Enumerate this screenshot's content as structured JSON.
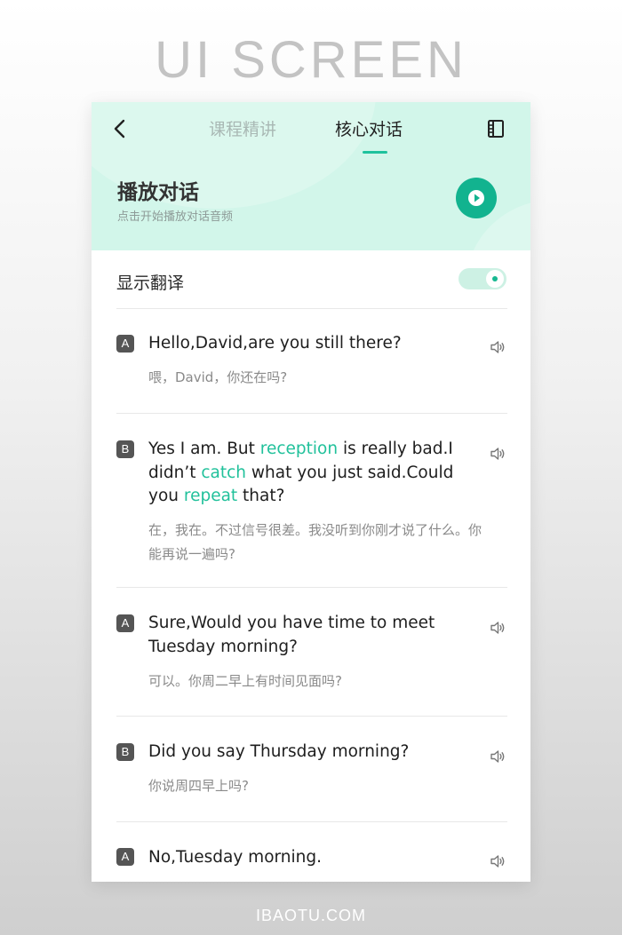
{
  "banner": {
    "title": "UI SCREEN"
  },
  "footer": {
    "watermark": "IBAOTU.COM"
  },
  "colors": {
    "accent": "#12b38f",
    "header_bg": "#d2f6ea",
    "highlight": "#21c19b"
  },
  "header": {
    "back_icon": "chevron-left-icon",
    "tabs": [
      {
        "label": "课程精讲",
        "active": false
      },
      {
        "label": "核心对话",
        "active": true
      }
    ],
    "menu_icon": "book-icon",
    "play_title": "播放对话",
    "play_subtitle": "点击开始播放对话音频",
    "play_icon": "play-icon"
  },
  "translation": {
    "label": "显示翻译",
    "enabled": true
  },
  "dialogue": [
    {
      "speaker": "A",
      "english": [
        {
          "t": "Hello,David,are you still there?"
        }
      ],
      "chinese": "喂，David，你还在吗?"
    },
    {
      "speaker": "B",
      "english": [
        {
          "t": "Yes I am. But "
        },
        {
          "t": "reception",
          "hl": true
        },
        {
          "t": " is really bad.I didn’t "
        },
        {
          "t": "catch",
          "hl": true
        },
        {
          "t": " what you just said.Could you "
        },
        {
          "t": "repeat",
          "hl": true
        },
        {
          "t": " that?"
        }
      ],
      "chinese": "在，我在。不过信号很差。我没听到你刚才说了什么。你能再说一遍吗?"
    },
    {
      "speaker": "A",
      "english": [
        {
          "t": "Sure,Would you have time to meet Tuesday morning?"
        }
      ],
      "chinese": "可以。你周二早上有时间见面吗?"
    },
    {
      "speaker": "B",
      "english": [
        {
          "t": "Did you say Thursday morning?"
        }
      ],
      "chinese": "你说周四早上吗?"
    },
    {
      "speaker": "A",
      "english": [
        {
          "t": "No,Tuesday morning."
        }
      ],
      "chinese": ""
    }
  ]
}
